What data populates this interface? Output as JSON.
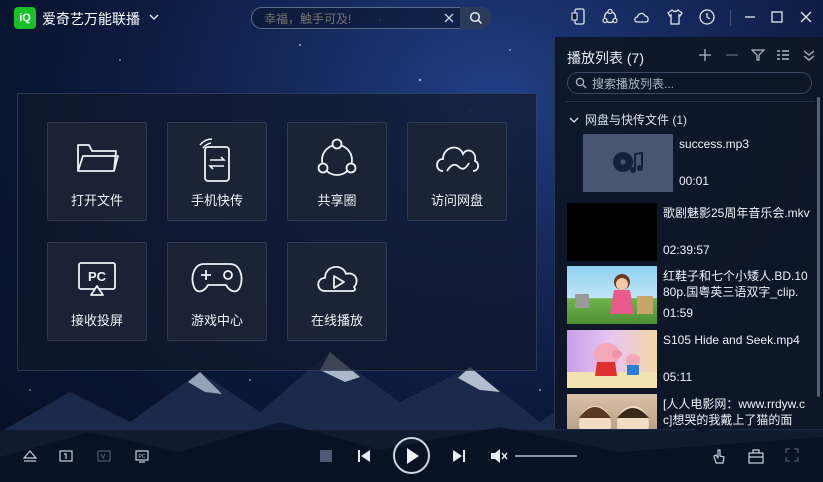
{
  "app": {
    "title": "爱奇艺万能联播",
    "logo_text": "iQ"
  },
  "search": {
    "placeholder": "幸福，触手可及!"
  },
  "titlebar_icons": [
    "phone-mirror-icon",
    "share-icon",
    "cloud-icon",
    "skin-icon",
    "history-icon",
    "minimize-icon",
    "maximize-icon",
    "close-icon"
  ],
  "features": [
    {
      "label": "打开文件",
      "icon": "folder-icon"
    },
    {
      "label": "手机快传",
      "icon": "phone-transfer-icon"
    },
    {
      "label": "共享圈",
      "icon": "share-circle-icon"
    },
    {
      "label": "访问网盘",
      "icon": "cloud-drive-icon"
    },
    {
      "label": "接收投屏",
      "icon": "pc-cast-icon"
    },
    {
      "label": "游戏中心",
      "icon": "gamepad-icon"
    },
    {
      "label": "在线播放",
      "icon": "cloud-play-icon"
    }
  ],
  "playlist": {
    "title": "播放列表 (7)",
    "search_placeholder": "搜索播放列表...",
    "group": "网盘与快传文件 (1)",
    "items": [
      {
        "name": "success.mp3",
        "duration": "00:01",
        "thumb": "music"
      },
      {
        "name": "歌剧魅影25周年音乐会.mkv",
        "duration": "02:39:57",
        "thumb": "black"
      },
      {
        "name": "红鞋子和七个小矮人.BD.1080p.国粤英三语双字_clip.",
        "duration": "01:59",
        "thumb": "cartoon"
      },
      {
        "name": "S105 Hide and Seek.mp4",
        "duration": "05:11",
        "thumb": "peppa"
      },
      {
        "name": "[人人电影网：www.rrdyw.cc]想哭的我戴上了猫的面",
        "duration": "",
        "thumb": "anime"
      }
    ]
  },
  "colors": {
    "accent": "#19c02a",
    "panel": "#1c2436",
    "text": "#eef2f8"
  }
}
